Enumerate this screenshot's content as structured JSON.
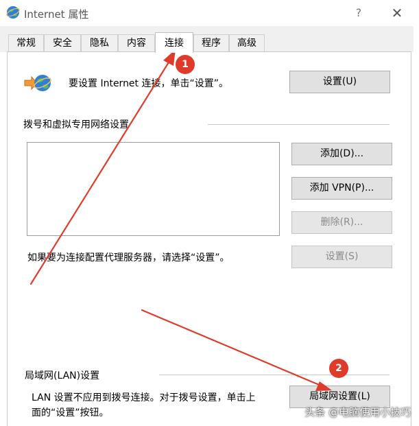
{
  "window": {
    "title": "Internet 属性",
    "help_label": "?",
    "close_label": "✕"
  },
  "tabs": [
    {
      "label": "常规"
    },
    {
      "label": "安全"
    },
    {
      "label": "隐私"
    },
    {
      "label": "内容"
    },
    {
      "label": "连接",
      "active": true
    },
    {
      "label": "程序"
    },
    {
      "label": "高级"
    }
  ],
  "setup": {
    "text": "要设置 Internet 连接，单击“设置”。",
    "button": "设置(U)"
  },
  "dialup": {
    "group_title": "拨号和虚拟专用网络设置",
    "add_button": "添加(D)...",
    "add_vpn_button": "添加 VPN(P)...",
    "delete_button": "删除(R)...",
    "settings_button": "设置(S)",
    "proxy_hint": "如果要为连接配置代理服务器，请选择“设置”。"
  },
  "lan": {
    "group_title": "局域网(LAN)设置",
    "description_line1": "LAN 设置不应用到拨号连接。对于拨号设置，单击上",
    "description_line2": "面的“设置”按钮。",
    "button": "局域网设置(L)"
  },
  "annotations": {
    "badge1": "1",
    "badge2": "2",
    "arrow_color": "#e03a2b"
  },
  "watermark": "头条 @电脑使用小技巧"
}
